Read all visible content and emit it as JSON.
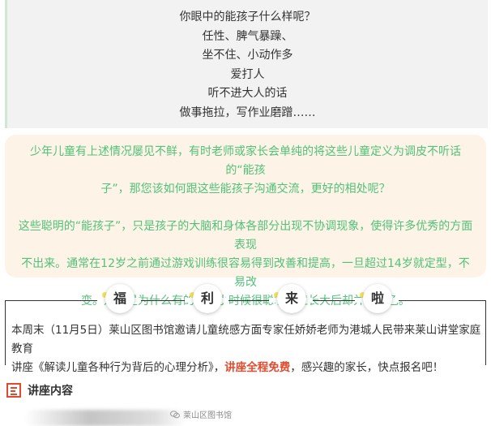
{
  "quote": {
    "lines": [
      "你眼中的能孩子什么样呢？",
      "任性、脾气暴躁、",
      "坐不住、小动作多",
      "爱打人",
      "听不进大人的话",
      "做事拖拉，写作业磨蹭……"
    ]
  },
  "card": {
    "para1": [
      "少年儿童有上述情况屡见不鲜，有时老师或家长会单纯的将这些儿童定义为调皮不听话的“能孩",
      "子”，那您该如何跟这些能孩子沟通交流，更好的相处呢？"
    ],
    "para2": [
      "这些聪明的“能孩子”，只是孩子的大脑和身体各部分出现不协调现象，使得许多优秀的方面表现",
      "不出来。通常在12岁之前通过游戏训练很容易得到改善和提高，一旦超过14岁就定型，不易改",
      "变。这就是为什么有的孩子小时候很聪明，但长大后却并不出色。"
    ],
    "text_color": "#52c17a",
    "bg_color": "#fdf3e6"
  },
  "welfare": {
    "chars": [
      "福",
      "利",
      "来",
      "啦"
    ],
    "dot_color": "#f3e35a"
  },
  "notice": {
    "line1": "本周末（11月5日）莱山区图书馆邀请儿童统感方面专家任娇娇老师为港城人民带来莱山讲堂家庭教育",
    "line2_pre": "讲座《解读儿童各种行为背后的心理分析》，",
    "line2_red": "讲座全程免费",
    "line2_post": "，感兴趣的家长，快点报名吧！",
    "accent": "#e04a2e"
  },
  "section": {
    "icon": "list-icon",
    "title": "讲座内容"
  },
  "watermark": {
    "icon": "wechat-icon",
    "text": "莱山区图书馆"
  }
}
